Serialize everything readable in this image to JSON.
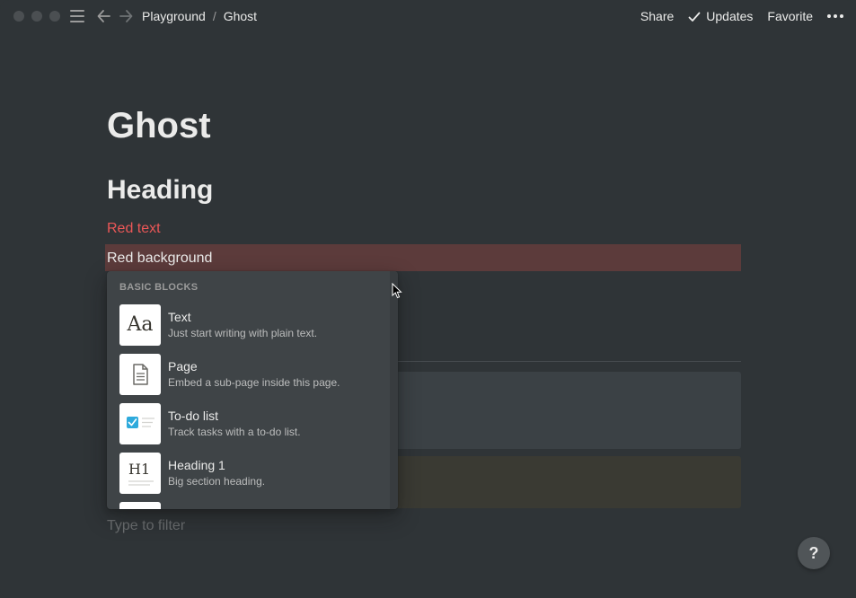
{
  "topbar": {
    "breadcrumbs": [
      "Playground",
      "Ghost"
    ],
    "breadcrumb_separator": "/",
    "share_label": "Share",
    "updates_label": "Updates",
    "favorite_label": "Favorite"
  },
  "page": {
    "title": "Ghost",
    "heading": "Heading",
    "red_text": "Red text",
    "red_background_text": "Red background",
    "filter_placeholder": "Type to filter"
  },
  "menu": {
    "header": "BASIC BLOCKS",
    "items": [
      {
        "title": "Text",
        "desc": "Just start writing with plain text.",
        "icon": "text-block-icon"
      },
      {
        "title": "Page",
        "desc": "Embed a sub-page inside this page.",
        "icon": "page-block-icon"
      },
      {
        "title": "To-do list",
        "desc": "Track tasks with a to-do list.",
        "icon": "todo-block-icon"
      },
      {
        "title": "Heading 1",
        "desc": "Big section heading.",
        "icon": "heading1-block-icon"
      }
    ],
    "text_thumb_glyph": "Aa",
    "heading_thumb_glyph": "H1"
  },
  "help_label": "?",
  "colors": {
    "background": "#2f3437",
    "red_text": "#eb5757",
    "red_background": "#5c3b3b",
    "menu_background": "#3f4447",
    "todo_check": "#2eaadc"
  }
}
